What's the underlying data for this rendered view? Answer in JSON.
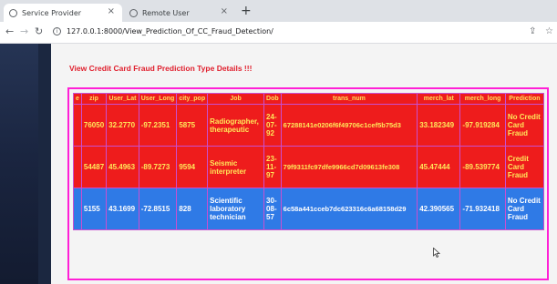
{
  "browser": {
    "tabs": [
      {
        "title": "Service Provider",
        "active": true
      },
      {
        "title": "Remote User",
        "active": false
      }
    ],
    "new_tab": "+",
    "close_glyph": "×",
    "url": "127.0.0.1:8000/View_Prediction_Of_CC_Fraud_Detection/"
  },
  "page": {
    "title": "View Credit Card Fraud Prediction Type Details !!!"
  },
  "table": {
    "headers": [
      "e",
      "zip",
      "User_Lat",
      "User_Long",
      "city_pop",
      "Job",
      "Dob",
      "trans_num",
      "merch_lat",
      "merch_long",
      "Prediction"
    ],
    "rows": [
      {
        "cut": "",
        "zip": "76050",
        "lat": "32.2770",
        "long": "-97.2351",
        "city_pop": "5875",
        "job": "Radiographer, therapeutic",
        "dob": "24-07-92",
        "trans_num": "67288141e0206f6f49706c1cef5b75d3",
        "merch_lat": "33.182349",
        "merch_long": "-97.919284",
        "prediction": "No Credit Card Fraud"
      },
      {
        "cut": "",
        "zip": "54487",
        "lat": "45.4963",
        "long": "-89.7273",
        "city_pop": "9594",
        "job": "Seismic interpreter",
        "dob": "23-11-97",
        "trans_num": "79f9311fc97dfe9966cd7d09613fe308",
        "merch_lat": "45.47444",
        "merch_long": "-89.539774",
        "prediction": "Credit Card Fraud"
      },
      {
        "cut": "",
        "zip": "5155",
        "lat": "43.1699",
        "long": "-72.8515",
        "city_pop": "828",
        "job": "Scientific laboratory technician",
        "dob": "30-08-57",
        "trans_num": "6c58a441cceb7dc623316c6a68158d29",
        "merch_lat": "42.390565",
        "merch_long": "-71.932418",
        "prediction": "No Credit Card Fraud"
      }
    ]
  },
  "colors": {
    "header_bg": "#ee1c1c",
    "header_text": "#ffe05a",
    "cell_text": "#ffe85a",
    "border": "#ff20d6",
    "title": "#e0202e",
    "selection": "#2f7ae6"
  },
  "icons": [
    "globe-icon",
    "close-icon",
    "back-arrow-icon",
    "forward-arrow-icon",
    "reload-icon",
    "info-icon",
    "share-icon",
    "star-icon",
    "mouse-cursor-icon"
  ]
}
